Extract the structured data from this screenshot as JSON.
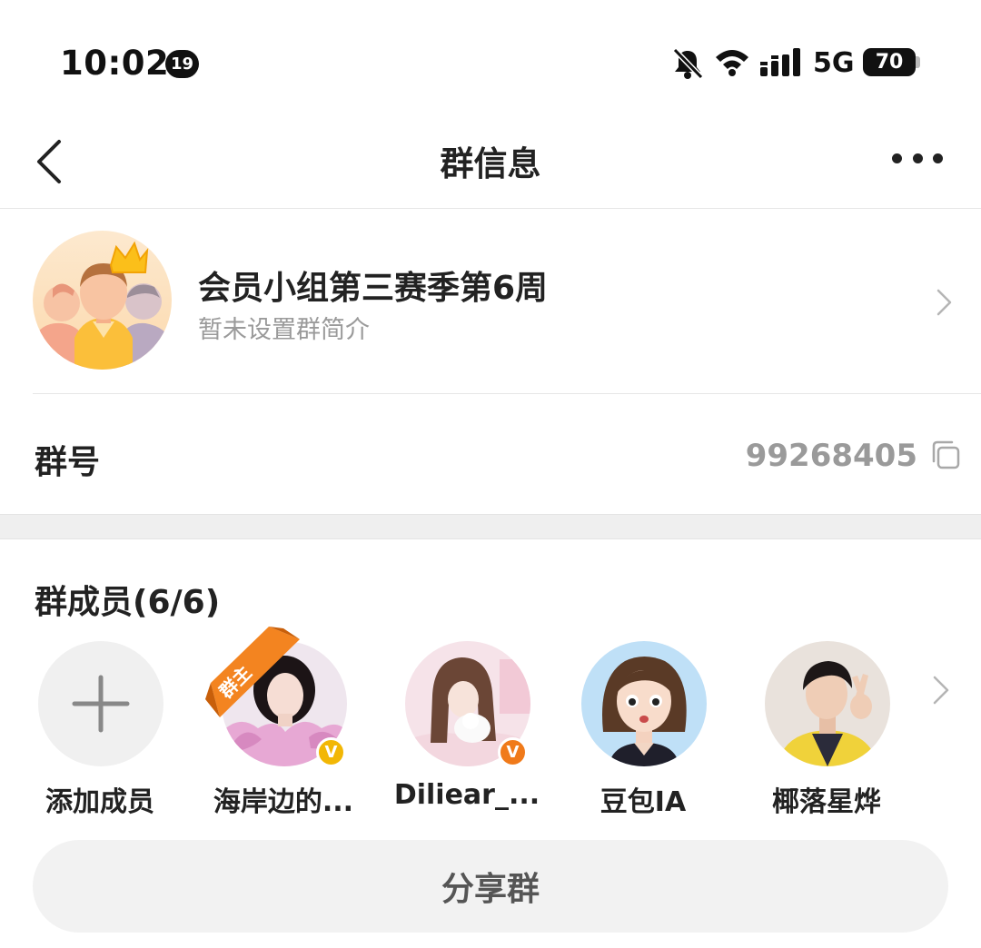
{
  "status_bar": {
    "time": "10:02",
    "notification_count": "19",
    "network": "5G",
    "battery": "70"
  },
  "nav": {
    "title": "群信息",
    "back_icon": "chevron-left-icon",
    "more_icon": "more-dots-icon"
  },
  "group": {
    "name": "会员小组第三赛季第6周",
    "description": "暂未设置群简介"
  },
  "group_id": {
    "label": "群号",
    "value": "99268405"
  },
  "members": {
    "title": "群成员(6/6)",
    "add_label": "添加成员",
    "owner_tag": "群主",
    "list": [
      {
        "name": "海岸边的...",
        "badge": "V",
        "badge_color": "#f2b705",
        "is_owner": true
      },
      {
        "name": "Diliear_...",
        "badge": "V",
        "badge_color": "#f07a1a",
        "is_owner": false
      },
      {
        "name": "豆包IA",
        "badge": "",
        "is_owner": false
      },
      {
        "name": "椰落星烨",
        "badge": "",
        "is_owner": false
      }
    ]
  },
  "share_button": "分享群",
  "colors": {
    "accent_orange": "#f07a1a",
    "text_gray": "#9a9a9a"
  }
}
